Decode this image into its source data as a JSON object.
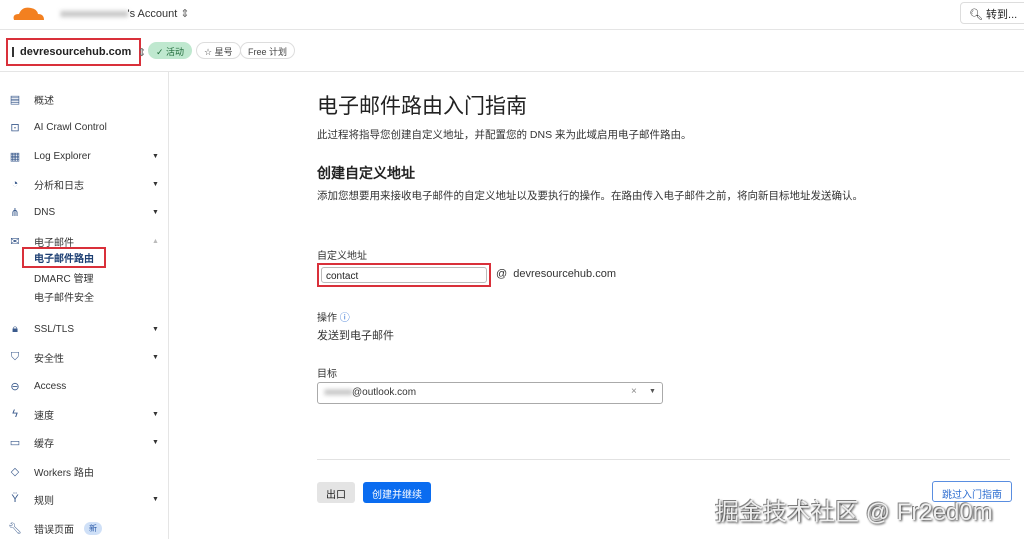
{
  "topbar": {
    "account_blurred": "xxxxxxxxxxxxxxx",
    "account_suffix": "'s Account",
    "search_label": "转到..."
  },
  "zone": {
    "name": "devresourcehub.com",
    "status": "活动",
    "star": "星号",
    "plan": "Free 计划"
  },
  "sidebar": {
    "items": [
      {
        "label": "概述",
        "icon": "document-icon"
      },
      {
        "label": "AI Crawl Control",
        "icon": "robot-icon"
      },
      {
        "label": "Log Explorer",
        "icon": "log-icon",
        "caret": true
      },
      {
        "label": "分析和日志",
        "icon": "chart-icon",
        "caret": true
      },
      {
        "label": "DNS",
        "icon": "network-icon",
        "caret": true
      },
      {
        "label": "电子邮件",
        "icon": "mail-icon",
        "expanded": true
      },
      {
        "label": "SSL/TLS",
        "icon": "lock-icon",
        "caret": true
      },
      {
        "label": "安全性",
        "icon": "shield-icon",
        "caret": true
      },
      {
        "label": "Access",
        "icon": "access-icon"
      },
      {
        "label": "速度",
        "icon": "lightning-icon",
        "caret": true
      },
      {
        "label": "缓存",
        "icon": "cache-icon",
        "caret": true
      },
      {
        "label": "Workers 路由",
        "icon": "workers-icon"
      },
      {
        "label": "规则",
        "icon": "rules-icon",
        "caret": true
      },
      {
        "label": "错误页面",
        "icon": "wrench-icon",
        "badge": "新"
      }
    ],
    "email_sub": [
      "电子邮件路由",
      "DMARC 管理",
      "电子邮件安全"
    ]
  },
  "main": {
    "title": "电子邮件路由入门指南",
    "intro": "此过程将指导您创建自定义地址，并配置您的 DNS 来为此域启用电子邮件路由。",
    "section_title": "创建自定义地址",
    "section_desc": "添加您想要用来接收电子邮件的自定义地址以及要执行的操作。在路由传入电子邮件之前，将向新目标地址发送确认。",
    "custom_label": "自定义地址",
    "custom_value": "contact",
    "domain_suffix": "@  devresourcehub.com",
    "action_label": "操作",
    "action_value": "发送到电子邮件",
    "target_label": "目标",
    "target_blurred": "xxxxxxx",
    "target_suffix": "@outlook.com",
    "exit_button": "出口",
    "create_button": "创建并继续",
    "skip_button": "跳过入门指南"
  },
  "watermark": "掘金技术社区 @ Fr2ed0m"
}
